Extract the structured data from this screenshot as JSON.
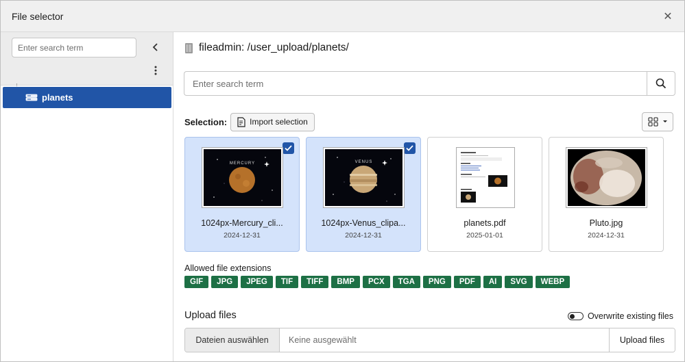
{
  "modal": {
    "title": "File selector"
  },
  "tree": {
    "search_placeholder": "Enter search term",
    "nodes": [
      {
        "label": "planets"
      }
    ]
  },
  "main": {
    "path": "fileadmin: /user_upload/planets/",
    "search_placeholder": "Enter search term",
    "selection_label": "Selection:",
    "import_label": "Import selection",
    "files": [
      {
        "name": "1024px-Mercury_cli...",
        "date": "2024-12-31",
        "selected": true,
        "thumb_caption": "MERCURY"
      },
      {
        "name": "1024px-Venus_clipa...",
        "date": "2024-12-31",
        "selected": true,
        "thumb_caption": "VENUS"
      },
      {
        "name": "planets.pdf",
        "date": "2025-01-01",
        "selected": false
      },
      {
        "name": "Pluto.jpg",
        "date": "2024-12-31",
        "selected": false
      }
    ],
    "allowed_label": "Allowed file extensions",
    "extensions": [
      "GIF",
      "JPG",
      "JPEG",
      "TIF",
      "TIFF",
      "BMP",
      "PCX",
      "TGA",
      "PNG",
      "PDF",
      "AI",
      "SVG",
      "WEBP"
    ],
    "upload": {
      "title": "Upload files",
      "overwrite_label": "Overwrite existing files",
      "choose_label": "Dateien auswählen",
      "status": "Keine ausgewählt",
      "upload_label": "Upload files"
    }
  },
  "colors": {
    "accent": "#2155a7",
    "selected_card": "#d4e3fb",
    "badge": "#1d7045"
  },
  "icons": [
    "close-icon",
    "chevron-left-icon",
    "more-vertical-icon",
    "folder-icon",
    "storage-icon",
    "search-icon",
    "import-icon",
    "grid-view-icon",
    "caret-down-icon",
    "check-icon"
  ]
}
